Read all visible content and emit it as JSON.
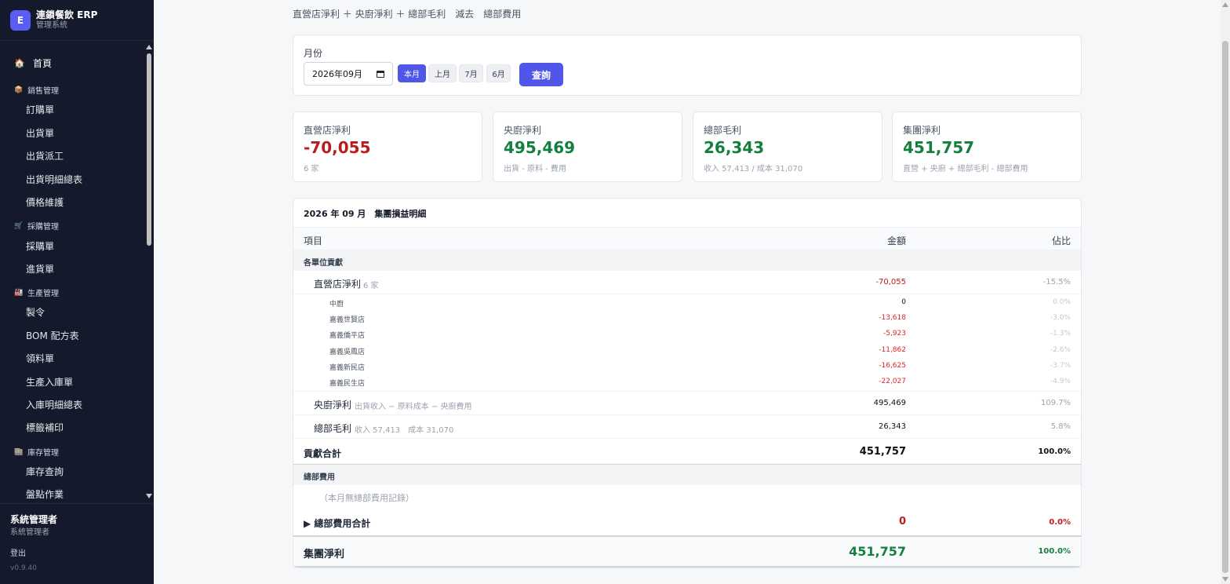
{
  "brand": {
    "logo_letter": "E",
    "title": "連鎖餐飲 ERP",
    "subtitle": "管理系統"
  },
  "nav": {
    "home": {
      "icon": "house-icon",
      "label": "首頁"
    },
    "sections": [
      {
        "icon": "box-icon",
        "label": "銷售管理",
        "items": [
          "訂購單",
          "出貨單",
          "出貨派工",
          "出貨明細總表",
          "價格維護"
        ]
      },
      {
        "icon": "cart-icon",
        "label": "採購管理",
        "items": [
          "採購單",
          "進貨單"
        ]
      },
      {
        "icon": "factory-icon",
        "label": "生產管理",
        "items": [
          "製令",
          "BOM 配方表",
          "領料單",
          "生產入庫單",
          "入庫明細總表",
          "標籤補印"
        ]
      },
      {
        "icon": "warehouse-icon",
        "label": "庫存管理",
        "items": [
          "庫存查詢",
          "盤點作業"
        ]
      }
    ]
  },
  "footer": {
    "user_name": "系統管理者",
    "user_role": "系統管理者",
    "logout": "登出",
    "version": "v0.9.40"
  },
  "formula": "直營店淨利 ＋ 央廚淨利 ＋ 總部毛利　減去　總部費用",
  "filter": {
    "label": "月份",
    "month_value": "2026年09月",
    "quick_buttons": [
      "本月",
      "上月",
      "7月",
      "6月"
    ],
    "active_button": "本月",
    "query_label": "查詢"
  },
  "stats": [
    {
      "label": "直營店淨利",
      "value": "-70,055",
      "sub": "6 家",
      "tone": "negative"
    },
    {
      "label": "央廚淨利",
      "value": "495,469",
      "sub": "出貨 - 原料 - 費用",
      "tone": "positive"
    },
    {
      "label": "總部毛利",
      "value": "26,343",
      "sub": "收入 57,413 / 成本 31,070",
      "tone": "positive"
    },
    {
      "label": "集團淨利",
      "value": "451,757",
      "sub": "直營 + 央廚 + 總部毛利 - 總部費用",
      "tone": "positive"
    }
  ],
  "detail": {
    "title": "2026 年 09 月　集團損益明細",
    "headers": {
      "item": "項目",
      "amount": "金額",
      "share": "佔比"
    },
    "contribution_group": "各單位貢獻",
    "store_row": {
      "label": "直營店淨利",
      "note": "6 家",
      "amount": "-70,055",
      "share": "-15.5%"
    },
    "stores": [
      {
        "name": "中廚",
        "amount": "0",
        "share": "0.0%"
      },
      {
        "name": "嘉義世賢店",
        "amount": "-13,618",
        "share": "-3.0%"
      },
      {
        "name": "嘉義僑平店",
        "amount": "-5,923",
        "share": "-1.3%"
      },
      {
        "name": "嘉義吳鳳店",
        "amount": "-11,862",
        "share": "-2.6%"
      },
      {
        "name": "嘉義新民店",
        "amount": "-16,625",
        "share": "-3.7%"
      },
      {
        "name": "嘉義民生店",
        "amount": "-22,027",
        "share": "-4.9%"
      }
    ],
    "kitchen_row": {
      "label": "央廚淨利",
      "note": "出貨收入 − 原料成本 − 央廚費用",
      "amount": "495,469",
      "share": "109.7%"
    },
    "hq_row": {
      "label": "總部毛利",
      "note": "收入 57,413　成本 31,070",
      "amount": "26,343",
      "share": "5.8%"
    },
    "contribution_total": {
      "label": "貢獻合計",
      "amount": "451,757",
      "share": "100.0%"
    },
    "expense_group": "總部費用",
    "expense_empty": "（本月無總部費用記錄）",
    "expense_total": {
      "label": "▶ 總部費用合計",
      "amount": "0",
      "share": "0.0%"
    },
    "group_total": {
      "label": "集團淨利",
      "amount": "451,757",
      "share": "100.0%"
    }
  },
  "colors": {
    "accent": "#4f56e8",
    "negative": "#b91c1c",
    "positive": "#15803d",
    "sidebar": "#141a2b"
  }
}
